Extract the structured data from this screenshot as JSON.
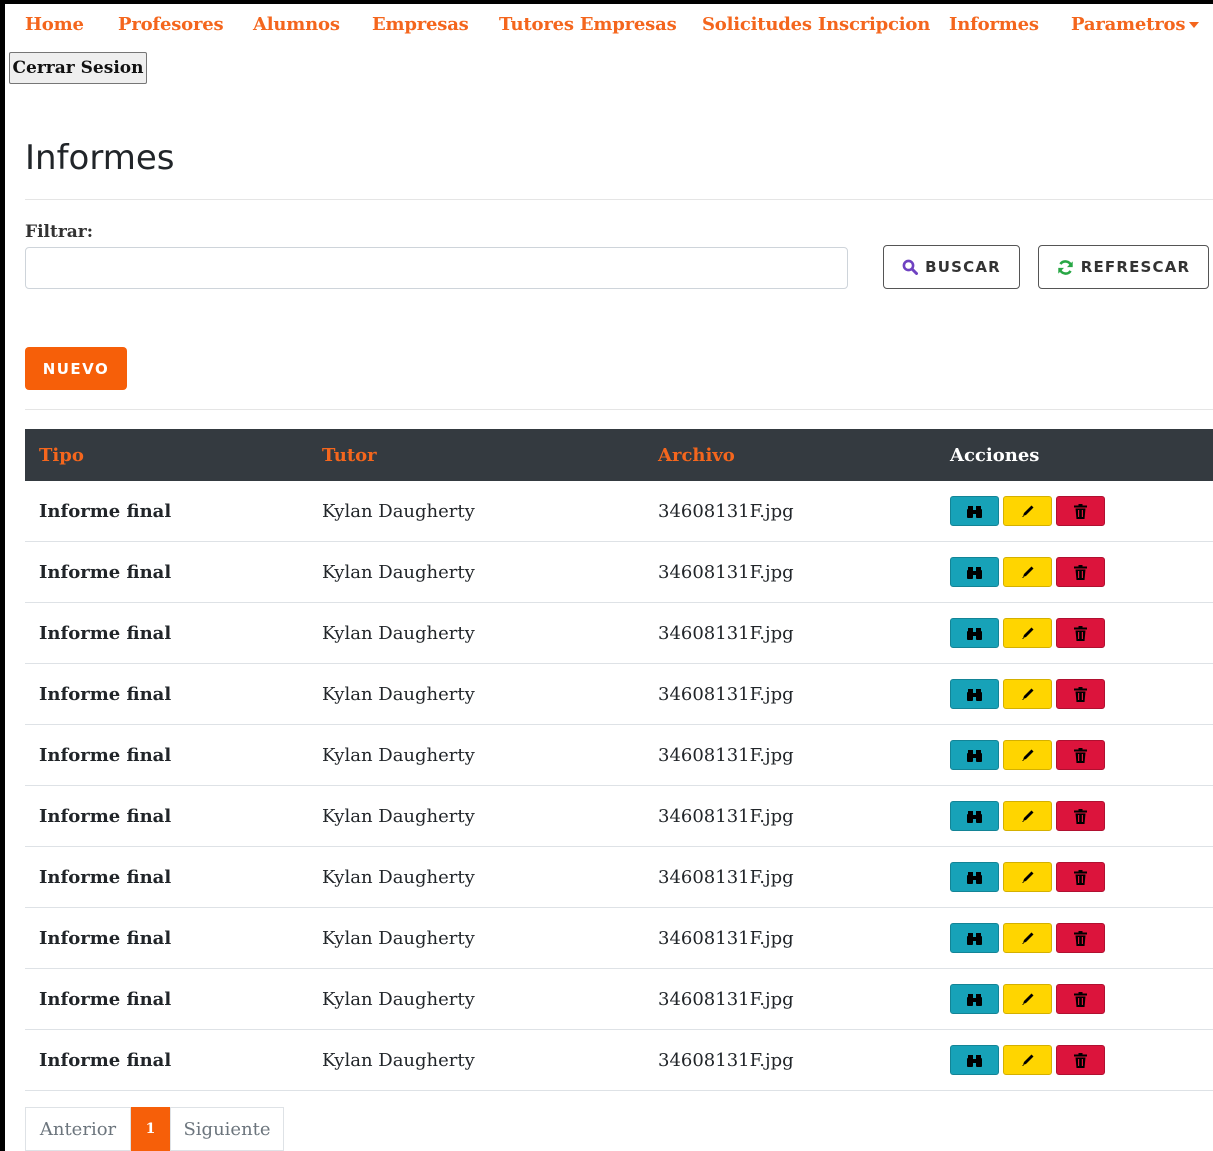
{
  "nav": {
    "items": [
      "Home",
      "Profesores",
      "Alumnos",
      "Empresas",
      "Tutores Empresas",
      "Solicitudes Inscripcion",
      "Informes",
      "Parametros"
    ],
    "logout_label": "Cerrar Sesion"
  },
  "page": {
    "title": "Informes"
  },
  "filter": {
    "label": "Filtrar:",
    "value": "",
    "placeholder": ""
  },
  "buttons": {
    "search_label": "BUSCAR",
    "refresh_label": "REFRESCAR",
    "new_label": "NUEVO"
  },
  "table": {
    "headers": [
      "Tipo",
      "Tutor",
      "Archivo",
      "Acciones"
    ],
    "rows": [
      {
        "tipo": "Informe final",
        "tutor": "Kylan Daugherty",
        "archivo": "34608131F.jpg"
      },
      {
        "tipo": "Informe final",
        "tutor": "Kylan Daugherty",
        "archivo": "34608131F.jpg"
      },
      {
        "tipo": "Informe final",
        "tutor": "Kylan Daugherty",
        "archivo": "34608131F.jpg"
      },
      {
        "tipo": "Informe final",
        "tutor": "Kylan Daugherty",
        "archivo": "34608131F.jpg"
      },
      {
        "tipo": "Informe final",
        "tutor": "Kylan Daugherty",
        "archivo": "34608131F.jpg"
      },
      {
        "tipo": "Informe final",
        "tutor": "Kylan Daugherty",
        "archivo": "34608131F.jpg"
      },
      {
        "tipo": "Informe final",
        "tutor": "Kylan Daugherty",
        "archivo": "34608131F.jpg"
      },
      {
        "tipo": "Informe final",
        "tutor": "Kylan Daugherty",
        "archivo": "34608131F.jpg"
      },
      {
        "tipo": "Informe final",
        "tutor": "Kylan Daugherty",
        "archivo": "34608131F.jpg"
      },
      {
        "tipo": "Informe final",
        "tutor": "Kylan Daugherty",
        "archivo": "34608131F.jpg"
      }
    ],
    "row_actions": [
      {
        "name": "view",
        "icon": "binoculars-icon"
      },
      {
        "name": "edit",
        "icon": "pencil-icon"
      },
      {
        "name": "delete",
        "icon": "trash-icon"
      }
    ]
  },
  "pagination": {
    "prev_label": "Anterior",
    "current_page": "1",
    "next_label": "Siguiente"
  },
  "colors": {
    "accent": "#f65f09",
    "header_bg": "#343a40",
    "view": "#17a2b8",
    "edit": "#ffd500",
    "delete": "#dc143c"
  }
}
